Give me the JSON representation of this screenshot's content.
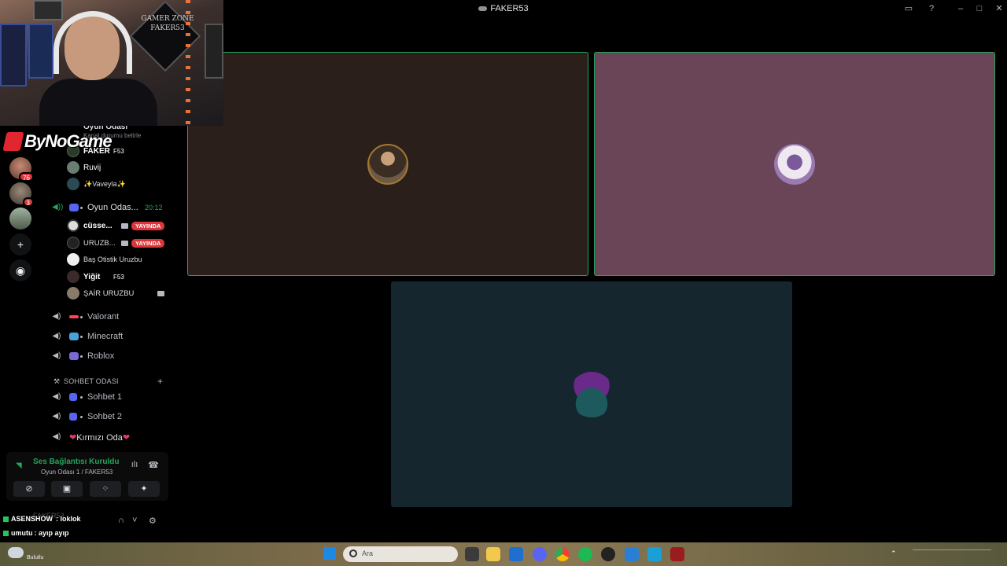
{
  "window": {
    "title": "FAKER53",
    "controls": [
      "inbox-icon",
      "help-icon",
      "minimize-icon",
      "maximize-icon",
      "close-icon"
    ]
  },
  "overlay": {
    "logo_text": "ByNoGame",
    "webcam_sign": "GAMER ZONE FAKER53"
  },
  "servers": [
    {
      "badge": "76"
    },
    {
      "badge": "3"
    },
    {
      "badge": ""
    }
  ],
  "channels": {
    "top_partial": {
      "title": "Oyun Odası",
      "sub": "Kanal durumu belirle"
    },
    "top_users": [
      {
        "name": "FAKER",
        "tag": "F53"
      },
      {
        "name": "Ruvij",
        "tag": ""
      },
      {
        "name": "✨Vaveyla✨",
        "tag": ""
      }
    ],
    "active_channel": {
      "name": "Oyun Odas...",
      "timer": "20:12"
    },
    "active_users": [
      {
        "name": "cüsse...",
        "badge": "YAYINDA",
        "camera": true
      },
      {
        "name": "URUZB...",
        "badge": "YAYINDA",
        "camera": true
      },
      {
        "name": "Baş Otistik Uruzbu",
        "badge": "",
        "camera": false
      },
      {
        "name": "Yiğit",
        "tag": "F53",
        "badge": "",
        "camera": false
      },
      {
        "name": "ŞAİR URUZBU",
        "badge": "",
        "camera": true
      }
    ],
    "voice_channels": [
      "Valorant",
      "Minecraft",
      "Roblox"
    ],
    "category": "SOHBET ODASI",
    "chat_channels": [
      "Sohbet 1",
      "Sohbet 2",
      "Kırmızı Oda"
    ]
  },
  "voice_panel": {
    "status": "Ses Bağlantısı Kuruldu",
    "sub": "Oyun Odası 1 / FAKER53",
    "buttons": [
      "camera-off-icon",
      "screen-share-icon",
      "activities-icon",
      "soundboard-icon"
    ]
  },
  "chat_overlay": [
    {
      "user": "ASENSHOW",
      "text": ": loklok"
    },
    {
      "user": "umutu",
      "text": ": ayıp ayıp"
    }
  ],
  "user_bar": {
    "name": "FAKER53"
  },
  "tiles": [
    {
      "color": "#2a1f1a",
      "speaking": true
    },
    {
      "color": "#6a4457",
      "speaking": true
    },
    {
      "color": "#15262e",
      "speaking": false
    }
  ],
  "taskbar": {
    "search_placeholder": "Ara",
    "weather": "Bulutlu"
  }
}
